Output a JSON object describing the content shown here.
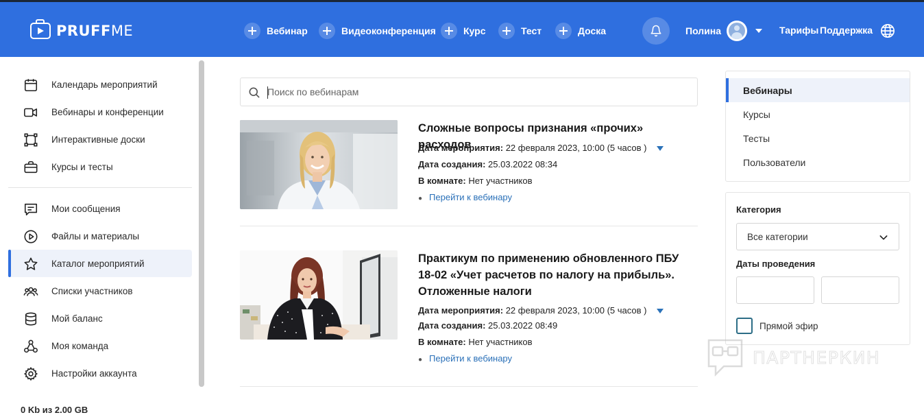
{
  "brand": {
    "name_bold": "PRUFF",
    "name_light": "ME"
  },
  "header": {
    "create_buttons": [
      "Вебинар",
      "Видеоконференция",
      "Курс",
      "Тест",
      "Доска"
    ],
    "user_name": "Полина",
    "links": {
      "tariffs": "Тарифы",
      "support": "Поддержка"
    }
  },
  "sidebar": {
    "items": [
      {
        "label": "Календарь мероприятий",
        "icon": "calendar-icon"
      },
      {
        "label": "Вебинары и конференции",
        "icon": "video-camera-icon"
      },
      {
        "label": "Интерактивные доски",
        "icon": "whiteboard-icon"
      },
      {
        "label": "Курсы и тесты",
        "icon": "briefcase-icon"
      },
      {
        "label": "Мои сообщения",
        "icon": "message-icon"
      },
      {
        "label": "Файлы и материалы",
        "icon": "play-circle-icon"
      },
      {
        "label": "Каталог мероприятий",
        "icon": "star-icon",
        "active": true
      },
      {
        "label": "Списки участников",
        "icon": "users-icon"
      },
      {
        "label": "Мой баланс",
        "icon": "database-icon"
      },
      {
        "label": "Моя команда",
        "icon": "team-icon"
      },
      {
        "label": "Настройки аккаунта",
        "icon": "gear-icon"
      }
    ],
    "storage": "0 Kb из 2.00 GB"
  },
  "search": {
    "placeholder": "Поиск по вебинарам"
  },
  "webinars": [
    {
      "title": "Сложные вопросы признания «прочих» расходов",
      "event_date_label": "Дата мероприятия:",
      "event_date": "22 февраля 2023, 10:00 (5 часов )",
      "created_label": "Дата создания:",
      "created": "25.03.2022 08:34",
      "room_label": "В комнате:",
      "room": "Нет участников",
      "link": "Перейти к вебинару"
    },
    {
      "title": "Практикум по применению обновленного ПБУ 18-02 «Учет расчетов по налогу на прибыль». Отложенные налоги",
      "event_date_label": "Дата мероприятия:",
      "event_date": "22 февраля 2023, 10:00 (5 часов )",
      "created_label": "Дата создания:",
      "created": "25.03.2022 08:49",
      "room_label": "В комнате:",
      "room": "Нет участников",
      "link": "Перейти к вебинару"
    }
  ],
  "right_nav": [
    "Вебинары",
    "Курсы",
    "Тесты",
    "Пользователи"
  ],
  "filters": {
    "category_label": "Категория",
    "category_value": "Все категории",
    "dates_label": "Даты проведения",
    "live_label": "Прямой эфир"
  },
  "watermark": "ПАРТНЕРКИН",
  "colors": {
    "brand_blue": "#2f6fdf",
    "link_blue": "#2a70b8"
  }
}
